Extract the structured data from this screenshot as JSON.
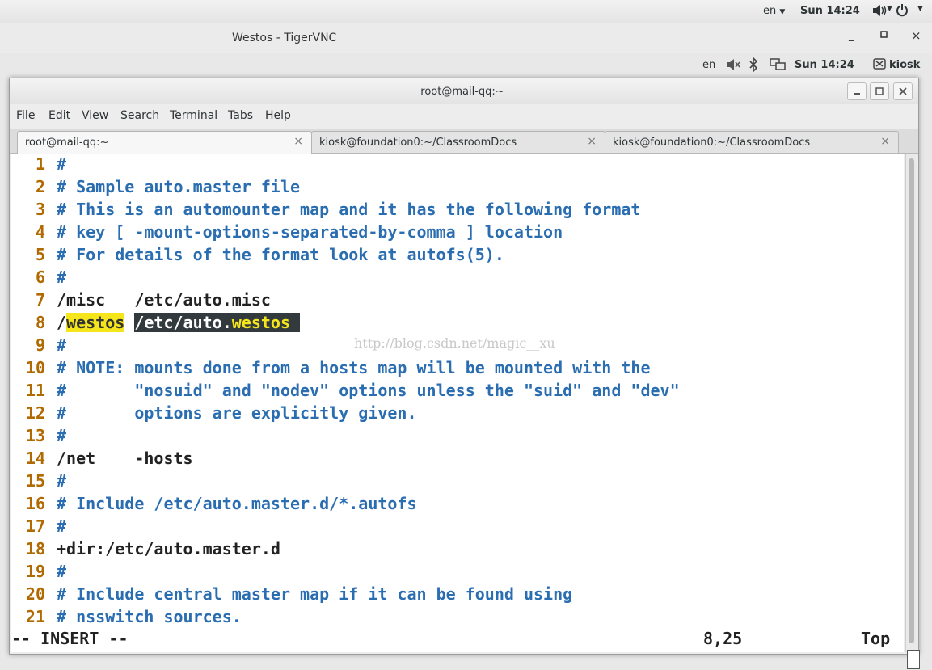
{
  "top_panel": {
    "lang": "en",
    "clock": "Sun 14:24"
  },
  "vnc_window": {
    "title": "Westos - TigerVNC",
    "minimize": "_",
    "maximize": "▫",
    "close": "×"
  },
  "remote_panel": {
    "lang": "en",
    "clock": "Sun 14:24",
    "user": "kiosk"
  },
  "terminal": {
    "title": "root@mail-qq:~",
    "menu": [
      "File",
      "Edit",
      "View",
      "Search",
      "Terminal",
      "Tabs",
      "Help"
    ],
    "tabs": [
      {
        "label": "root@mail-qq:~"
      },
      {
        "label": "kiosk@foundation0:~/ClassroomDocs"
      },
      {
        "label": "kiosk@foundation0:~/ClassroomDocs"
      }
    ],
    "lines": [
      {
        "n": "1",
        "text": "#"
      },
      {
        "n": "2",
        "text": "# Sample auto.master file"
      },
      {
        "n": "3",
        "text": "# This is an automounter map and it has the following format"
      },
      {
        "n": "4",
        "text": "# key [ -mount-options-separated-by-comma ] location"
      },
      {
        "n": "5",
        "text": "# For details of the format look at autofs(5)."
      },
      {
        "n": "6",
        "text": "#"
      },
      {
        "n": "7",
        "text": "/misc   /etc/auto.misc"
      },
      {
        "n": "8",
        "pre": "/",
        "search1": "westos",
        "mid": " ",
        "visual": "/etc/auto.",
        "visual_hl": "westos",
        "visual_tail": " "
      },
      {
        "n": "9",
        "text": "#"
      },
      {
        "n": "10",
        "text": "# NOTE: mounts done from a hosts map will be mounted with the"
      },
      {
        "n": "11",
        "text": "#       \"nosuid\" and \"nodev\" options unless the \"suid\" and \"dev\""
      },
      {
        "n": "12",
        "text": "#       options are explicitly given."
      },
      {
        "n": "13",
        "text": "#"
      },
      {
        "n": "14",
        "text": "/net    -hosts"
      },
      {
        "n": "15",
        "text": "#"
      },
      {
        "n": "16",
        "text": "# Include /etc/auto.master.d/*.autofs"
      },
      {
        "n": "17",
        "text": "#"
      },
      {
        "n": "18",
        "text": "+dir:/etc/auto.master.d"
      },
      {
        "n": "19",
        "text": "#"
      },
      {
        "n": "20",
        "text": "# Include central master map if it can be found using"
      },
      {
        "n": "21",
        "text": "# nsswitch sources."
      }
    ],
    "watermark": "http://blog.csdn.net/magic__xu",
    "status": {
      "mode": "-- INSERT --",
      "position": "8,25",
      "scroll": "Top"
    }
  }
}
